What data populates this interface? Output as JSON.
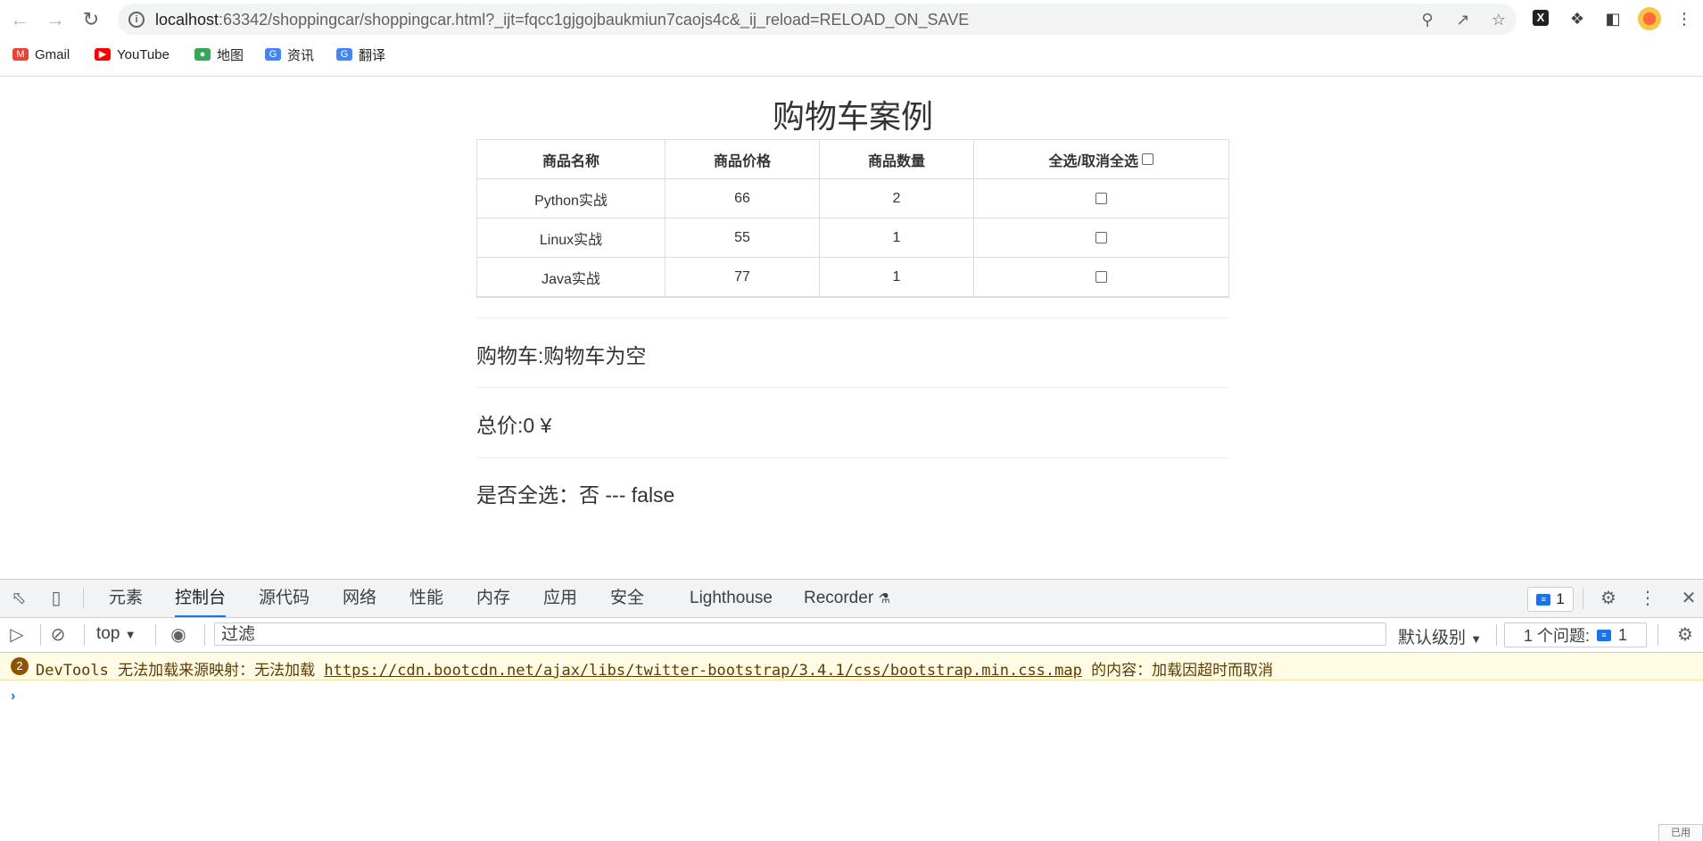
{
  "browser": {
    "url_host": "localhost",
    "url_rest": ":63342/shoppingcar/shoppingcar.html?_ijt=fqcc1gjgojbaukmiun7caojs4c&_ij_reload=RELOAD_ON_SAVE",
    "bookmarks": [
      {
        "label": "Gmail",
        "icon": "gmail-icon",
        "color": "#ea4335"
      },
      {
        "label": "YouTube",
        "icon": "youtube-icon",
        "color": "#ff0000"
      },
      {
        "label": "地图",
        "icon": "maps-icon",
        "color": "#34a853"
      },
      {
        "label": "资讯",
        "icon": "news-icon",
        "color": "#4285f4"
      },
      {
        "label": "翻译",
        "icon": "translate-icon",
        "color": "#4285f4"
      }
    ]
  },
  "page": {
    "title": "购物车案例",
    "table": {
      "headers": [
        "商品名称",
        "商品价格",
        "商品数量",
        "全选/取消全选"
      ],
      "rows": [
        {
          "name": "Python实战",
          "price": "66",
          "count": "2"
        },
        {
          "name": "Linux实战",
          "price": "55",
          "count": "1"
        },
        {
          "name": "Java实战",
          "price": "77",
          "count": "1"
        }
      ]
    },
    "cart_line": "购物车:购物车为空",
    "total_line": "总价:0 ¥",
    "select_all_line": "是否全选：否 --- false"
  },
  "devtools": {
    "tabs": [
      "元素",
      "控制台",
      "源代码",
      "网络",
      "性能",
      "内存",
      "应用",
      "安全",
      "Lighthouse",
      "Recorder"
    ],
    "active_tab": "控制台",
    "issue_count": "1",
    "context": "top",
    "filter_placeholder": "过滤",
    "level": "默认级别",
    "issues_label": "1 个问题:",
    "warning": {
      "count": "2",
      "prefix": "DevTools 无法加载来源映射：无法加载 ",
      "link": "https://cdn.bootcdn.net/ajax/libs/twitter-bootstrap/3.4.1/css/bootstrap.min.css.map",
      "suffix": " 的内容：加载因超时而取消"
    },
    "corner_tip": "已用"
  }
}
